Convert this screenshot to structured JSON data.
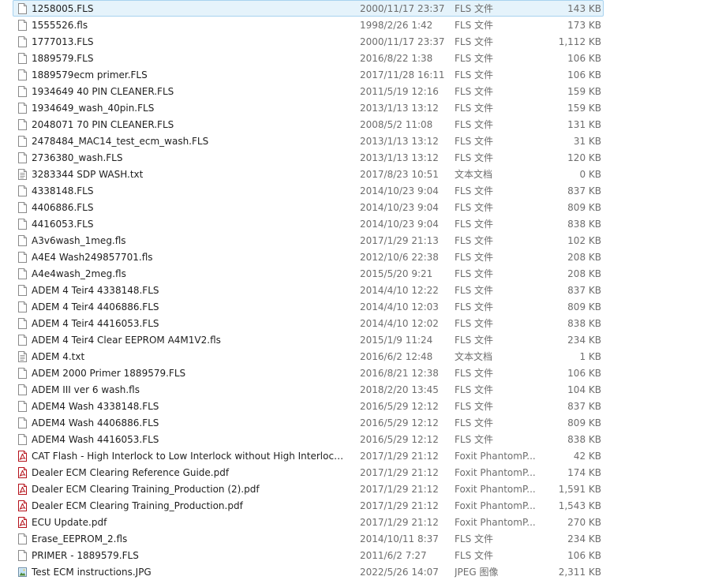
{
  "files": [
    {
      "name": "1258005.FLS",
      "date": "2000/11/17 23:37",
      "type": "FLS 文件",
      "size": "143 KB",
      "icon": "generic-file-icon"
    },
    {
      "name": "1555526.fls",
      "date": "1998/2/26 1:42",
      "type": "FLS 文件",
      "size": "173 KB",
      "icon": "generic-file-icon"
    },
    {
      "name": "1777013.FLS",
      "date": "2000/11/17 23:37",
      "type": "FLS 文件",
      "size": "1,112 KB",
      "icon": "generic-file-icon"
    },
    {
      "name": "1889579.FLS",
      "date": "2016/8/22 1:38",
      "type": "FLS 文件",
      "size": "106 KB",
      "icon": "generic-file-icon"
    },
    {
      "name": "1889579ecm primer.FLS",
      "date": "2017/11/28 16:11",
      "type": "FLS 文件",
      "size": "106 KB",
      "icon": "generic-file-icon"
    },
    {
      "name": "1934649   40 PIN CLEANER.FLS",
      "date": "2011/5/19 12:16",
      "type": "FLS 文件",
      "size": "159 KB",
      "icon": "generic-file-icon"
    },
    {
      "name": "1934649_wash_40pin.FLS",
      "date": "2013/1/13 13:12",
      "type": "FLS 文件",
      "size": "159 KB",
      "icon": "generic-file-icon"
    },
    {
      "name": "2048071  70 PIN CLEANER.FLS",
      "date": "2008/5/2 11:08",
      "type": "FLS 文件",
      "size": "131 KB",
      "icon": "generic-file-icon"
    },
    {
      "name": "2478484_MAC14_test_ecm_wash.FLS",
      "date": "2013/1/13 13:12",
      "type": "FLS 文件",
      "size": "31 KB",
      "icon": "generic-file-icon"
    },
    {
      "name": "2736380_wash.FLS",
      "date": "2013/1/13 13:12",
      "type": "FLS 文件",
      "size": "120 KB",
      "icon": "generic-file-icon"
    },
    {
      "name": "3283344 SDP WASH.txt",
      "date": "2017/8/23 10:51",
      "type": "文本文档",
      "size": "0 KB",
      "icon": "text-file-icon"
    },
    {
      "name": "4338148.FLS",
      "date": "2014/10/23 9:04",
      "type": "FLS 文件",
      "size": "837 KB",
      "icon": "generic-file-icon"
    },
    {
      "name": "4406886.FLS",
      "date": "2014/10/23 9:04",
      "type": "FLS 文件",
      "size": "809 KB",
      "icon": "generic-file-icon"
    },
    {
      "name": "4416053.FLS",
      "date": "2014/10/23 9:04",
      "type": "FLS 文件",
      "size": "838 KB",
      "icon": "generic-file-icon"
    },
    {
      "name": "A3v6wash_1meg.fls",
      "date": "2017/1/29 21:13",
      "type": "FLS 文件",
      "size": "102 KB",
      "icon": "generic-file-icon"
    },
    {
      "name": "A4E4 Wash249857701.fls",
      "date": "2012/10/6 22:38",
      "type": "FLS 文件",
      "size": "208 KB",
      "icon": "generic-file-icon"
    },
    {
      "name": "A4e4wash_2meg.fls",
      "date": "2015/5/20 9:21",
      "type": "FLS 文件",
      "size": "208 KB",
      "icon": "generic-file-icon"
    },
    {
      "name": "ADEM 4 Teir4 4338148.FLS",
      "date": "2014/4/10 12:22",
      "type": "FLS 文件",
      "size": "837 KB",
      "icon": "generic-file-icon"
    },
    {
      "name": "ADEM 4 Teir4 4406886.FLS",
      "date": "2014/4/10 12:03",
      "type": "FLS 文件",
      "size": "809 KB",
      "icon": "generic-file-icon"
    },
    {
      "name": "ADEM 4 Teir4 4416053.FLS",
      "date": "2014/4/10 12:02",
      "type": "FLS 文件",
      "size": "838 KB",
      "icon": "generic-file-icon"
    },
    {
      "name": "ADEM 4 Teir4 Clear EEPROM A4M1V2.fls",
      "date": "2015/1/9 11:24",
      "type": "FLS 文件",
      "size": "234 KB",
      "icon": "generic-file-icon"
    },
    {
      "name": "ADEM 4.txt",
      "date": "2016/6/2 12:48",
      "type": "文本文档",
      "size": "1 KB",
      "icon": "text-file-icon"
    },
    {
      "name": "ADEM 2000 Primer 1889579.FLS",
      "date": "2016/8/21 12:38",
      "type": "FLS 文件",
      "size": "106 KB",
      "icon": "generic-file-icon"
    },
    {
      "name": "ADEM III ver 6 wash.fls",
      "date": "2018/2/20 13:45",
      "type": "FLS 文件",
      "size": "104 KB",
      "icon": "generic-file-icon"
    },
    {
      "name": "ADEM4 Wash 4338148.FLS",
      "date": "2016/5/29 12:12",
      "type": "FLS 文件",
      "size": "837 KB",
      "icon": "generic-file-icon"
    },
    {
      "name": "ADEM4 Wash 4406886.FLS",
      "date": "2016/5/29 12:12",
      "type": "FLS 文件",
      "size": "809 KB",
      "icon": "generic-file-icon"
    },
    {
      "name": "ADEM4 Wash 4416053.FLS",
      "date": "2016/5/29 12:12",
      "type": "FLS 文件",
      "size": "838 KB",
      "icon": "generic-file-icon"
    },
    {
      "name": "CAT Flash - High Interlock to Low Interlock without High Interlock P...",
      "date": "2017/1/29 21:12",
      "type": "Foxit PhantomP...",
      "size": "42 KB",
      "icon": "pdf-file-icon"
    },
    {
      "name": "Dealer ECM Clearing Reference Guide.pdf",
      "date": "2017/1/29 21:12",
      "type": "Foxit PhantomP...",
      "size": "174 KB",
      "icon": "pdf-file-icon"
    },
    {
      "name": "Dealer ECM Clearing Training_Production (2).pdf",
      "date": "2017/1/29 21:12",
      "type": "Foxit PhantomP...",
      "size": "1,591 KB",
      "icon": "pdf-file-icon"
    },
    {
      "name": "Dealer ECM Clearing Training_Production.pdf",
      "date": "2017/1/29 21:12",
      "type": "Foxit PhantomP...",
      "size": "1,543 KB",
      "icon": "pdf-file-icon"
    },
    {
      "name": "ECU Update.pdf",
      "date": "2017/1/29 21:12",
      "type": "Foxit PhantomP...",
      "size": "270 KB",
      "icon": "pdf-file-icon"
    },
    {
      "name": "Erase_EEPROM_2.fls",
      "date": "2014/10/11 8:37",
      "type": "FLS 文件",
      "size": "234 KB",
      "icon": "generic-file-icon"
    },
    {
      "name": "PRIMER - 1889579.FLS",
      "date": "2011/6/2 7:27",
      "type": "FLS 文件",
      "size": "106 KB",
      "icon": "generic-file-icon"
    },
    {
      "name": "Test ECM instructions.JPG",
      "date": "2022/5/26 14:07",
      "type": "JPEG 图像",
      "size": "2,311 KB",
      "icon": "image-file-icon"
    }
  ],
  "selected_index": 0,
  "colors": {
    "selection_bg": "#e5f3fb",
    "selection_border": "#a8d2ef",
    "pdf_icon": "#b5121b",
    "secondary_text": "#6d6d6d"
  }
}
